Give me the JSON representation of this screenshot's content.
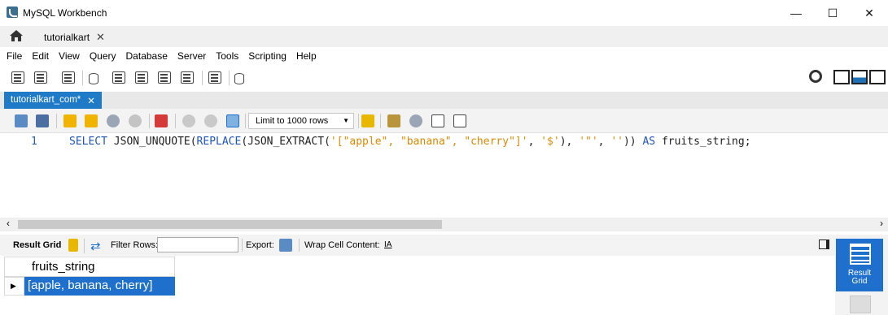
{
  "window": {
    "title": "MySQL Workbench",
    "minimize": "—",
    "maximize": "☐",
    "close": "✕"
  },
  "tabs": {
    "connection_tab": "tutorialkart",
    "close": "✕"
  },
  "menu": [
    "File",
    "Edit",
    "View",
    "Query",
    "Database",
    "Server",
    "Tools",
    "Scripting",
    "Help"
  ],
  "editor_tab": {
    "label": "tutorialkart_com*",
    "close": "✕"
  },
  "sql_toolbar": {
    "limit_rows": "Limit to 1000 rows"
  },
  "editor": {
    "line_number": "1",
    "sql": {
      "select": "SELECT",
      "unquote": "JSON_UNQUOTE(",
      "replace": "REPLACE",
      "extract": "(JSON_EXTRACT(",
      "json_literal": "'[\"apple\", \"banana\", \"cherry\"]'",
      "comma1": ", ",
      "path": "'$'",
      "close1": "), ",
      "quote_char": "'\"'",
      "comma2": ", ",
      "empty": "''",
      "close2": ")) ",
      "as": "AS",
      "alias": " fruits_string;"
    }
  },
  "result_toolbar": {
    "result_grid": "Result Grid",
    "filter_rows": "Filter Rows:",
    "export": "Export:",
    "wrap_cell": "Wrap Cell Content:"
  },
  "result_grid": {
    "column": "fruits_string",
    "rows": [
      "[apple, banana, cherry]"
    ]
  },
  "side_panel": {
    "result_grid_line1": "Result",
    "result_grid_line2": "Grid"
  },
  "colors": {
    "accent": "#1f6fcc",
    "keyword": "#1f55b8",
    "string": "#d98a00"
  }
}
